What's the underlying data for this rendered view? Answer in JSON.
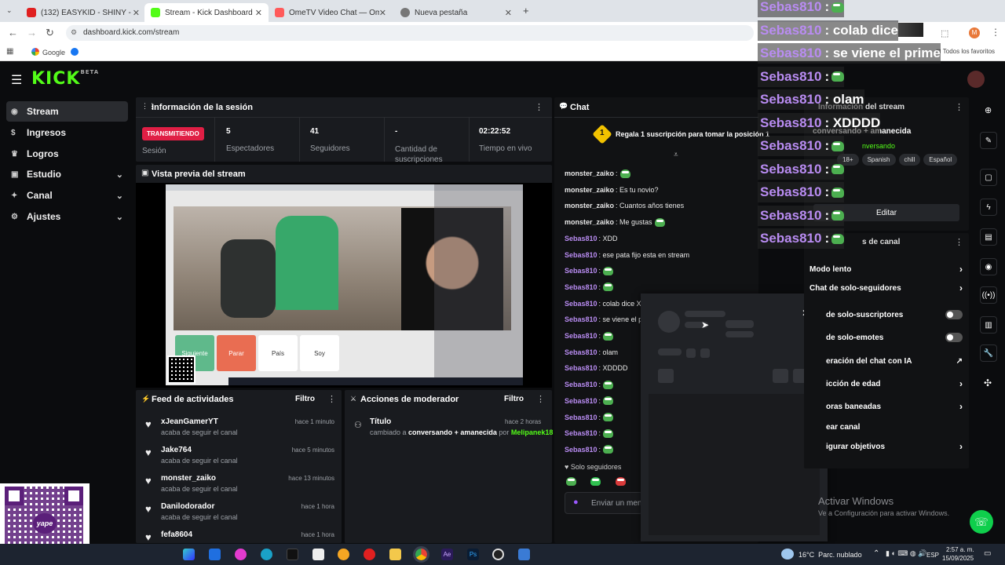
{
  "browser": {
    "tabs": [
      {
        "title": "(132) EASYKID - SHINY - YouTu",
        "color": "#e02020"
      },
      {
        "title": "Stream - Kick Dashboard",
        "color": "#53fc18"
      },
      {
        "title": "OmeTV Video Chat — Ome",
        "color": "#ff5a5a"
      },
      {
        "title": "Nueva pestaña",
        "color": "#777777"
      }
    ],
    "url": "dashboard.kick.com/stream",
    "bookmarks": [
      "Google"
    ],
    "all_favorites": "Todos los favoritos"
  },
  "kick": {
    "logo": "KICK",
    "logo_sup": "BETA",
    "sidebar": [
      {
        "label": "Stream",
        "icon": "stream-icon",
        "chevron": false
      },
      {
        "label": "Ingresos",
        "icon": "money-icon",
        "chevron": false
      },
      {
        "label": "Logros",
        "icon": "trophy-icon",
        "chevron": false
      },
      {
        "label": "Estudio",
        "icon": "studio-icon",
        "chevron": true
      },
      {
        "label": "Canal",
        "icon": "channel-icon",
        "chevron": true
      },
      {
        "label": "Ajustes",
        "icon": "gear-icon",
        "chevron": true
      }
    ]
  },
  "session": {
    "title": "Información de la sesión",
    "live_badge": "TRANSMITIENDO",
    "live_label": "Sesión",
    "stats": [
      {
        "value": "5",
        "label": "Espectadores"
      },
      {
        "value": "41",
        "label": "Seguidores"
      },
      {
        "value": "-",
        "label": "Cantidad de suscripciones"
      },
      {
        "value": "02:22:52",
        "label": "Tiempo en vivo"
      }
    ]
  },
  "preview": {
    "title": "Vista previa del stream",
    "btn_next": "Siguiente",
    "btn_stop": "Parar",
    "country": "País",
    "soy": "Soy"
  },
  "feed": {
    "title": "Feed de actividades",
    "filter": "Filtro",
    "items": [
      {
        "name": "xJeanGamerYT",
        "sub": "acaba de seguir el canal",
        "time": "hace 1 minuto"
      },
      {
        "name": "Jake764",
        "sub": "acaba de seguir el canal",
        "time": "hace 5 minutos"
      },
      {
        "name": "monster_zaiko",
        "sub": "acaba de seguir el canal",
        "time": "hace 13 minutos"
      },
      {
        "name": "Danilodorador",
        "sub": "acaba de seguir el canal",
        "time": "hace 1 hora"
      },
      {
        "name": "fefa8604",
        "sub": "",
        "time": "hace 1 hora"
      }
    ]
  },
  "mod": {
    "title": "Acciones de moderador",
    "filter": "Filtro",
    "item_title": "Título",
    "item_time": "hace 2 horas",
    "item_text_a": "cambiado a",
    "item_text_b": "conversando + amanecida",
    "item_text_c": "por",
    "item_user": "Melipanek18"
  },
  "chat": {
    "title": "Chat",
    "promo": "Regala 1 suscripción para tomar la posición 1",
    "promo_num": "1",
    "messages": [
      {
        "user": "monster_zaiko",
        "text": ":",
        "emote": true,
        "color": "#e8e8e8"
      },
      {
        "user": "monster_zaiko",
        "text": ": Es tu novio?",
        "emote": false,
        "color": "#e8e8e8"
      },
      {
        "user": "monster_zaiko",
        "text": ": Cuantos años tienes",
        "emote": false,
        "color": "#e8e8e8"
      },
      {
        "user": "monster_zaiko",
        "text": ": Me gustas",
        "emote": true,
        "color": "#e8e8e8"
      },
      {
        "user": "Sebas810",
        "text": ": XDD",
        "emote": false,
        "color": "#b98cf2"
      },
      {
        "user": "Sebas810",
        "text": ": ese pata fijo esta en stream",
        "emote": false,
        "color": "#b98cf2"
      },
      {
        "user": "Sebas810",
        "text": ":",
        "emote": true,
        "color": "#b98cf2"
      },
      {
        "user": "Sebas810",
        "text": ":",
        "emote": true,
        "color": "#b98cf2"
      },
      {
        "user": "Sebas810",
        "text": ": colab dice X",
        "emote": false,
        "color": "#b98cf2"
      },
      {
        "user": "Sebas810",
        "text": ": se viene el p",
        "emote": false,
        "color": "#b98cf2"
      },
      {
        "user": "Sebas810",
        "text": ":",
        "emote": true,
        "color": "#b98cf2"
      },
      {
        "user": "Sebas810",
        "text": ": olam",
        "emote": false,
        "color": "#b98cf2"
      },
      {
        "user": "Sebas810",
        "text": ": XDDDD",
        "emote": false,
        "color": "#b98cf2"
      },
      {
        "user": "Sebas810",
        "text": ":",
        "emote": true,
        "color": "#b98cf2"
      },
      {
        "user": "Sebas810",
        "text": ":",
        "emote": true,
        "color": "#b98cf2"
      },
      {
        "user": "Sebas810",
        "text": ":",
        "emote": true,
        "color": "#b98cf2"
      },
      {
        "user": "Sebas810",
        "text": ":",
        "emote": true,
        "color": "#b98cf2"
      },
      {
        "user": "Sebas810",
        "text": ":",
        "emote": true,
        "color": "#b98cf2"
      }
    ],
    "followers_only": "Solo seguidores",
    "input_placeholder": "Enviar un men"
  },
  "overlay": [
    {
      "user": "Sebas810",
      "text": ":"
    },
    {
      "user": "Sebas810",
      "text": ": colab dice"
    },
    {
      "user": "Sebas810",
      "text": ": se viene el prime"
    },
    {
      "user": "Sebas810",
      "text": ":"
    },
    {
      "user": "Sebas810",
      "text": ": olam"
    },
    {
      "user": "Sebas810",
      "text": ": XDDDD"
    },
    {
      "user": "Sebas810",
      "text": ":"
    },
    {
      "user": "Sebas810",
      "text": ":"
    },
    {
      "user": "Sebas810",
      "text": ":"
    },
    {
      "user": "Sebas810",
      "text": ":"
    },
    {
      "user": "Sebas810",
      "text": ":"
    }
  ],
  "stream_info": {
    "title": "Información del stream",
    "stream_title": "conversando + amanecida",
    "category": "nversando",
    "tags": [
      "18+",
      "Spanish",
      "chill",
      "Español"
    ],
    "edit": "Editar"
  },
  "channel_actions": {
    "title": "s de canal",
    "items": [
      {
        "label": "Modo lento",
        "kind": "chevron"
      },
      {
        "label": "Chat de solo-seguidores",
        "kind": "chevron"
      },
      {
        "label": "de solo-suscriptores",
        "kind": "toggle"
      },
      {
        "label": "de solo-emotes",
        "kind": "toggle"
      },
      {
        "label": "eración del chat con IA",
        "kind": "external"
      },
      {
        "label": "icción de edad",
        "kind": "chevron"
      },
      {
        "label": "oras baneadas",
        "kind": "chevron"
      },
      {
        "label": "ear canal",
        "kind": "none"
      },
      {
        "label": "igurar objetivos",
        "kind": "chevron"
      }
    ]
  },
  "windows": {
    "activate_title": "Activar Windows",
    "activate_sub": "Ve a Configuración para activar Windows.",
    "weather": "16°C  Parc. nublado",
    "lang": "ESP",
    "time": "2:57 a. m.",
    "date": "15/09/2025"
  },
  "qr": {
    "brand": "yape"
  }
}
